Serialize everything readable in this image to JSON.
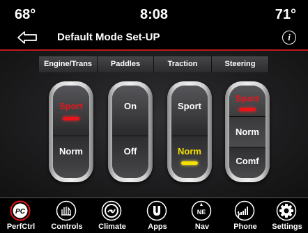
{
  "status": {
    "temp_left": "68°",
    "clock": "8:08",
    "temp_right": "71°"
  },
  "header": {
    "title": "Default Mode Set-UP",
    "info_label": "i"
  },
  "colors": {
    "accent_red": "#e8141a",
    "active_yellow": "#f5e000"
  },
  "columns": [
    {
      "label": "Engine/Trans",
      "top": "Sport",
      "bottom": "Norm",
      "active": "top"
    },
    {
      "label": "Paddles",
      "top": "On",
      "bottom": "Off",
      "active": "none"
    },
    {
      "label": "Traction",
      "top": "Sport",
      "bottom": "Norm",
      "active": "bottom"
    },
    {
      "label": "Steering",
      "top": "Sport",
      "middle": "Norm",
      "bottom": "Comf",
      "active": "top"
    }
  ],
  "nav": [
    {
      "label": "PerfCtrl",
      "icon": "perfctrl-icon",
      "icon_text": "PC"
    },
    {
      "label": "Controls",
      "icon": "controls-icon"
    },
    {
      "label": "Climate",
      "icon": "climate-icon"
    },
    {
      "label": "Apps",
      "icon": "apps-icon"
    },
    {
      "label": "Nav",
      "icon": "nav-icon",
      "icon_text": "NE"
    },
    {
      "label": "Phone",
      "icon": "phone-icon"
    },
    {
      "label": "Settings",
      "icon": "settings-icon"
    }
  ]
}
